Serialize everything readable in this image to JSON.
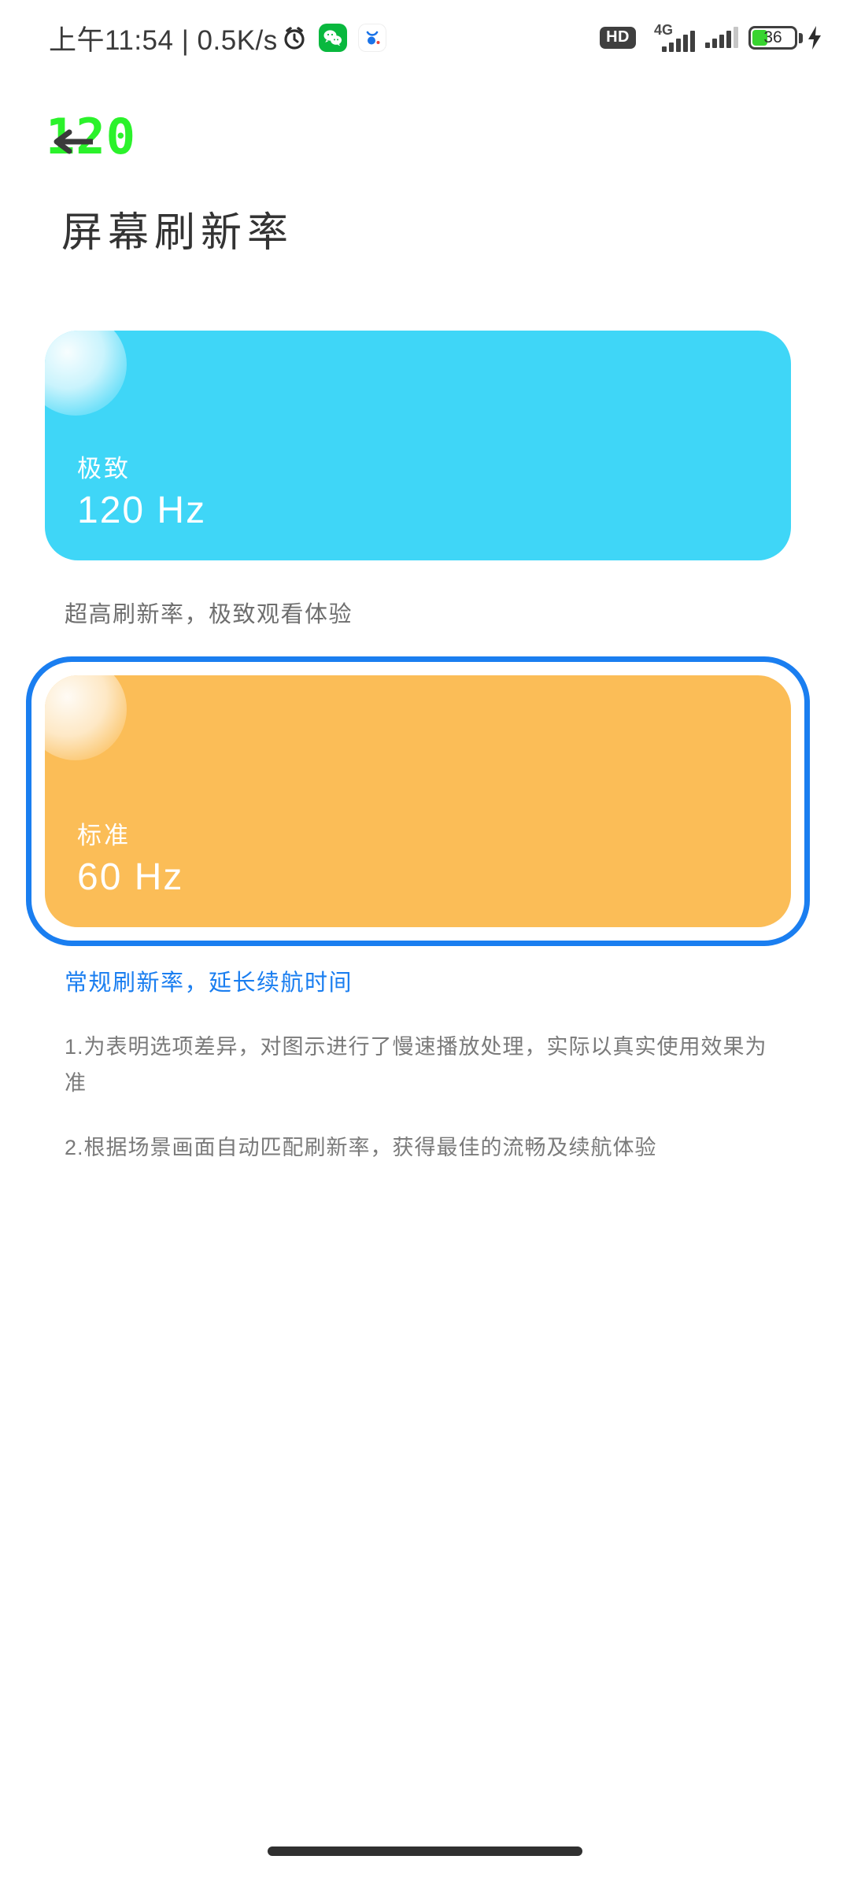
{
  "status_bar": {
    "time": "上午11:54",
    "separator": "|",
    "net_speed": "0.5K/s",
    "alarm_icon": "alarm-clock-icon",
    "app_icons": [
      {
        "name": "wechat-icon",
        "label": "WeChat"
      },
      {
        "name": "app-icon-white",
        "label": "App"
      }
    ],
    "hd_label": "HD",
    "network_type": "4G",
    "battery_percent": "36",
    "battery_fill_ratio": 0.36,
    "charging": true,
    "colors": {
      "icon_dark": "#3f3f3f",
      "battery_green": "#38d430"
    }
  },
  "fps_overlay": {
    "value": "120",
    "color": "#2bf22b"
  },
  "nav": {
    "back_label": "返回",
    "back_icon": "arrow-left-icon"
  },
  "page": {
    "title": "屏幕刷新率"
  },
  "options": [
    {
      "id": "option-120hz",
      "tag": "极致",
      "rate": "120 Hz",
      "caption": "超高刷新率，极致观看体验",
      "color": "#3fd6f7",
      "selected": false
    },
    {
      "id": "option-60hz",
      "tag": "标准",
      "rate": "60 Hz",
      "caption": "常规刷新率，延长续航时间",
      "color": "#fbbd57",
      "selected": true
    }
  ],
  "selection": {
    "ring_color": "#1a7ef0"
  },
  "footnotes": [
    "1.为表明选项差异，对图示进行了慢速播放处理，实际以真实使用效果为准",
    "2.根据场景画面自动匹配刷新率，获得最佳的流畅及续航体验"
  ],
  "system": {
    "home_indicator": "home-indicator-bar"
  }
}
